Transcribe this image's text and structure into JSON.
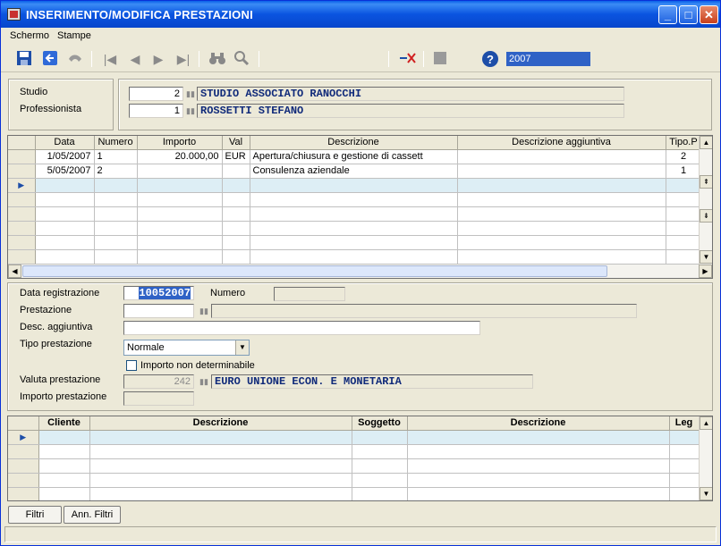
{
  "window": {
    "title": "INSERIMENTO/MODIFICA PRESTAZIONI",
    "min_glyph": "_",
    "max_glyph": "□",
    "close_glyph": "✕"
  },
  "menu": [
    {
      "label": "Schermo"
    },
    {
      "label": "Stampe"
    }
  ],
  "toolbar": {
    "icons": [
      "save-icon",
      "back-arrow-icon",
      "undo-icon",
      "first-record-icon",
      "previous-record-icon",
      "next-record-icon",
      "last-record-icon",
      "binoculars-icon",
      "magnifier-icon",
      "cancel-x-icon",
      "stop-icon",
      "help-icon"
    ],
    "year": "2007"
  },
  "header": {
    "studio_label": "Studio",
    "studio_code": "2",
    "studio_name": "STUDIO ASSOCIATO RANOCCHI",
    "professionista_label": "Professionista",
    "professionista_code": "1",
    "professionista_name": "ROSSETTI STEFANO"
  },
  "grid1": {
    "columns": [
      "Data",
      "Numero",
      "Importo",
      "Val",
      "Descrizione",
      "Descrizione aggiuntiva",
      "Tipo.P"
    ],
    "rows": [
      [
        "1/05/2007",
        "1",
        "20.000,00",
        "EUR",
        "Apertura/chiusura e gestione di cassett",
        "",
        "2"
      ],
      [
        "5/05/2007",
        "2",
        "",
        "",
        "Consulenza aziendale",
        "",
        "1"
      ],
      [
        "",
        "",
        "",
        "",
        "",
        "",
        ""
      ],
      [
        "",
        "",
        "",
        "",
        "",
        "",
        ""
      ],
      [
        "",
        "",
        "",
        "",
        "",
        "",
        ""
      ],
      [
        "",
        "",
        "",
        "",
        "",
        "",
        ""
      ],
      [
        "",
        "",
        "",
        "",
        "",
        "",
        ""
      ],
      [
        "",
        "",
        "",
        "",
        "",
        "",
        ""
      ]
    ],
    "current_row_marker": "▶"
  },
  "form": {
    "data_registrazione_label": "Data registrazione",
    "data_registrazione": "10052007",
    "numero_label": "Numero",
    "numero": "",
    "prestazione_label": "Prestazione",
    "prestazione_code": "",
    "prestazione_desc": "",
    "desc_aggiuntiva_label": "Desc. aggiuntiva",
    "desc_aggiuntiva": "",
    "tipo_prestazione_label": "Tipo prestazione",
    "tipo_prestazione": "Normale",
    "importo_non_det_label": "Importo non determinabile",
    "valuta_label": "Valuta prestazione",
    "valuta_code": "242",
    "valuta_desc": "EURO UNIONE ECON. E MONETARIA",
    "importo_label": "Importo prestazione",
    "importo": ""
  },
  "grid2": {
    "columns": [
      "Cliente",
      "Descrizione",
      "Soggetto",
      "Descrizione",
      "Leg"
    ],
    "rows": [
      [
        "",
        "",
        "",
        "",
        ""
      ],
      [
        "",
        "",
        "",
        "",
        ""
      ],
      [
        "",
        "",
        "",
        "",
        ""
      ],
      [
        "",
        "",
        "",
        "",
        ""
      ],
      [
        "",
        "",
        "",
        "",
        ""
      ]
    ],
    "current_row_marker": "▶"
  },
  "buttons": {
    "filtri": "Filtri",
    "ann_filtri": "Ann. Filtri"
  }
}
